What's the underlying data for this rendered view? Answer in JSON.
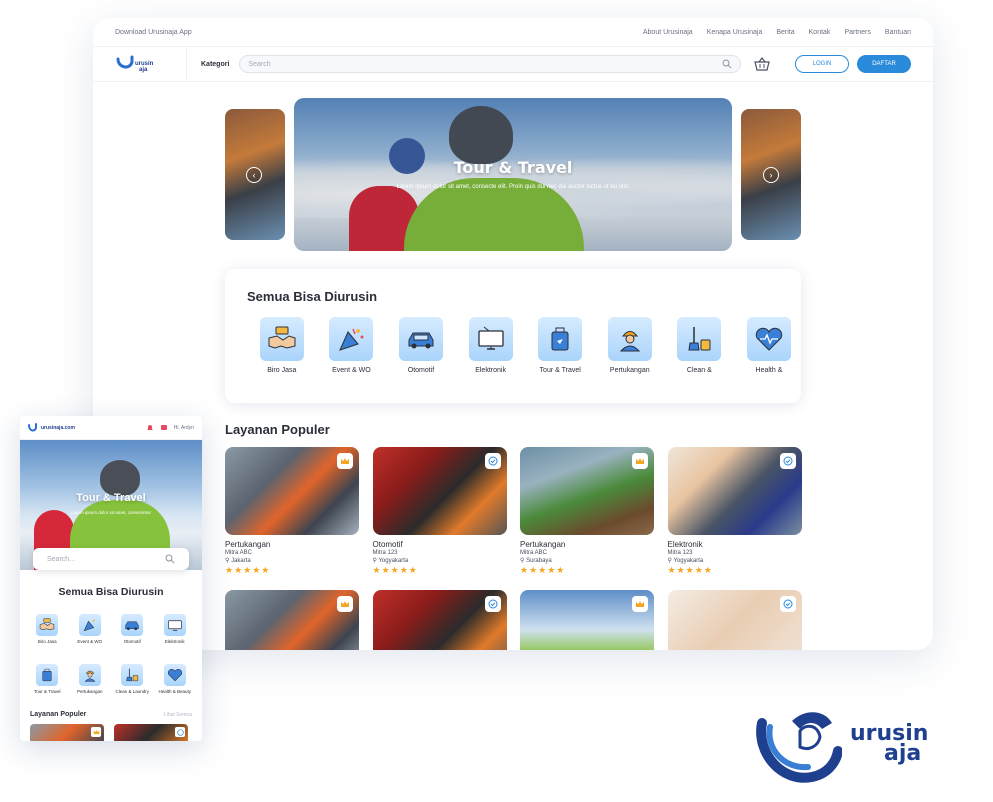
{
  "colors": {
    "primary": "#2a8bdc",
    "brand": "#1f3f8f",
    "star": "#f5a623"
  },
  "desktop": {
    "topbar": {
      "download": "Download Urusinaja App",
      "links": [
        "About Urusinaja",
        "Kenapa Urusinaja",
        "Berita",
        "Kontak",
        "Partners",
        "Bantuan"
      ]
    },
    "nav": {
      "logo_text": "urusinaja",
      "kategori": "Kategori",
      "search_placeholder": "Search",
      "login": "LOGIN",
      "daftar": "DAFTAR"
    },
    "hero": {
      "title": "Tour & Travel",
      "subtitle": "Lorem ipsum dolor sit amet, consecte elit. Proin quis dui nec dui auctor luctus ut eu nisl."
    },
    "categories": {
      "title": "Semua Bisa Diurusin",
      "items": [
        {
          "label": "Biro Jasa",
          "icon": "handshake-icon"
        },
        {
          "label": "Event & WO",
          "icon": "party-icon"
        },
        {
          "label": "Otomotif",
          "icon": "car-icon"
        },
        {
          "label": "Elektronik",
          "icon": "tv-icon"
        },
        {
          "label": "Tour & Travel",
          "icon": "luggage-icon"
        },
        {
          "label": "Pertukangan",
          "icon": "worker-icon"
        },
        {
          "label": "Clean &",
          "icon": "cleaning-icon"
        },
        {
          "label": "Health &",
          "icon": "heart-icon"
        }
      ]
    },
    "popular": {
      "title": "Layanan Populer",
      "items": [
        {
          "name": "Pertukangan",
          "vendor": "Mitra ABC",
          "location": "Jakarta",
          "stars": "★★★★★",
          "badge": "crown-icon"
        },
        {
          "name": "Otomotif",
          "vendor": "Mitra 123",
          "location": "Yogyakarta",
          "stars": "★★★★★",
          "badge": "verified-icon"
        },
        {
          "name": "Pertukangan",
          "vendor": "Mitra ABC",
          "location": "Surabaya",
          "stars": "★★★★★",
          "badge": "crown-icon"
        },
        {
          "name": "Elektronik",
          "vendor": "Mitra 123",
          "location": "Yogyakarta",
          "stars": "★★★★★",
          "badge": "verified-icon"
        }
      ],
      "location_prefix": "⚲"
    }
  },
  "mobile": {
    "url": "urusinaja.com",
    "greeting": "Hi, Ardyn",
    "hero_title": "Tour & Travel",
    "hero_sub": "Lorem ipsum dolor sit amet, consectetur",
    "search_placeholder": "Search...",
    "categories_title": "Semua Bisa Diurusin",
    "categories": [
      {
        "label": "Biro Jasa",
        "icon": "handshake-icon"
      },
      {
        "label": "Event & WO",
        "icon": "party-icon"
      },
      {
        "label": "Otomotif",
        "icon": "car-icon"
      },
      {
        "label": "Elektronik",
        "icon": "tv-icon"
      },
      {
        "label": "Tour & Travel",
        "icon": "luggage-icon"
      },
      {
        "label": "Pertukangan",
        "icon": "worker-icon"
      },
      {
        "label": "Clean & Laundry",
        "icon": "cleaning-icon"
      },
      {
        "label": "Health & Beauty",
        "icon": "heart-icon"
      }
    ],
    "popular_title": "Layanan Populer",
    "see_all": "Lihat Semua"
  },
  "brand_logo": {
    "line1": "urusin",
    "line2": "aja"
  }
}
